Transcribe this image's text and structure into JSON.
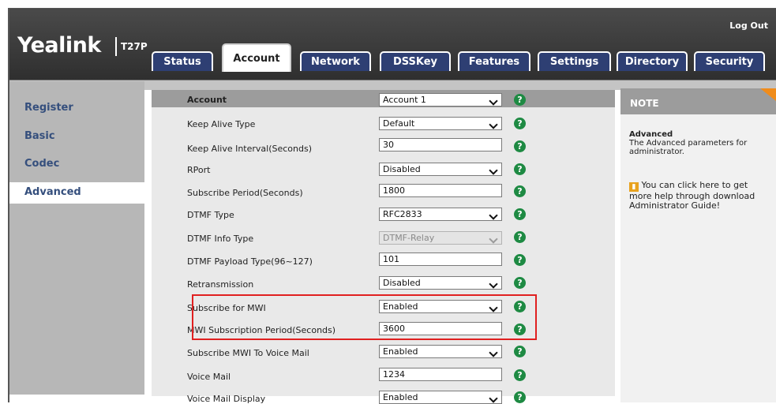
{
  "header": {
    "logo": "Yealink",
    "model": "T27P",
    "logout": "Log Out"
  },
  "tabs": [
    {
      "label": "Status"
    },
    {
      "label": "Account",
      "active": true
    },
    {
      "label": "Network"
    },
    {
      "label": "DSSKey"
    },
    {
      "label": "Features"
    },
    {
      "label": "Settings"
    },
    {
      "label": "Directory"
    },
    {
      "label": "Security"
    }
  ],
  "sidebar": {
    "items": [
      {
        "label": "Register"
      },
      {
        "label": "Basic"
      },
      {
        "label": "Codec"
      },
      {
        "label": "Advanced",
        "active": true
      }
    ]
  },
  "form": {
    "header": {
      "label": "Account",
      "value": "Account 1"
    },
    "rows": [
      {
        "label": "Keep Alive Type",
        "value": "Default",
        "type": "select"
      },
      {
        "label": "Keep Alive Interval(Seconds)",
        "value": "30",
        "type": "input"
      },
      {
        "label": "RPort",
        "value": "Disabled",
        "type": "select"
      },
      {
        "label": "Subscribe Period(Seconds)",
        "value": "1800",
        "type": "input"
      },
      {
        "label": "DTMF Type",
        "value": "RFC2833",
        "type": "select"
      },
      {
        "label": "DTMF Info Type",
        "value": "DTMF-Relay",
        "type": "select",
        "disabled": true
      },
      {
        "label": "DTMF Payload Type(96~127)",
        "value": "101",
        "type": "input"
      },
      {
        "label": "Retransmission",
        "value": "Disabled",
        "type": "select"
      },
      {
        "label": "Subscribe for MWI",
        "value": "Enabled",
        "type": "select"
      },
      {
        "label": "MWI Subscription Period(Seconds)",
        "value": "3600",
        "type": "input"
      },
      {
        "label": "Subscribe MWI To Voice Mail",
        "value": "Enabled",
        "type": "select"
      },
      {
        "label": "Voice Mail",
        "value": "1234",
        "type": "input"
      },
      {
        "label": "Voice Mail Display",
        "value": "Enabled",
        "type": "select"
      }
    ],
    "help_glyph": "?"
  },
  "note": {
    "heading": "NOTE",
    "title": "Advanced",
    "description": "The Advanced parameters for administrator.",
    "help_text": "You can click here to get more help through download Administrator Guide!"
  },
  "colors": {
    "tab_bg": "#2e3f73",
    "sidebar_bg": "#b7b7b7",
    "sidebar_text": "#354f7d",
    "help_icon": "#1e8a43",
    "highlight": "#e02020",
    "note_corner": "#f08c1b"
  }
}
